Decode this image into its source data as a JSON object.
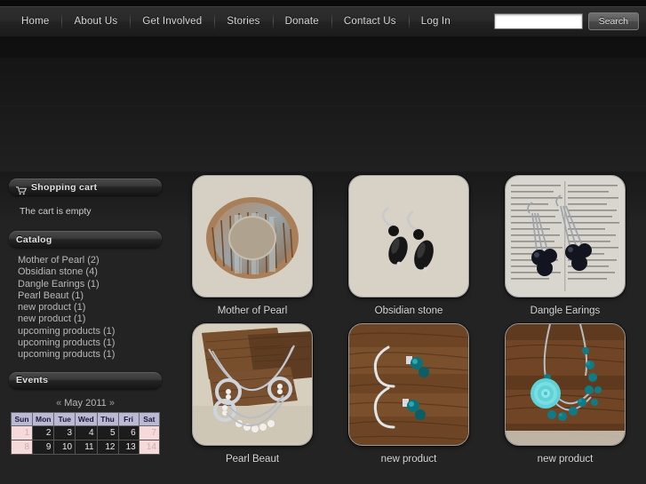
{
  "nav": {
    "items": [
      {
        "label": "Home"
      },
      {
        "label": "About Us"
      },
      {
        "label": "Get Involved"
      },
      {
        "label": "Stories"
      },
      {
        "label": "Donate"
      },
      {
        "label": "Contact Us"
      },
      {
        "label": "Log In"
      }
    ],
    "search": {
      "value": "",
      "placeholder": "",
      "button_label": "Search"
    }
  },
  "sidebar": {
    "cart": {
      "title": "Shopping cart",
      "icon": "shopping-cart-icon",
      "empty_text": "The cart is empty"
    },
    "catalog": {
      "title": "Catalog",
      "items": [
        {
          "label": "Mother of Pearl (2)"
        },
        {
          "label": "Obsidian stone (4)"
        },
        {
          "label": "Dangle Earings (1)"
        },
        {
          "label": "Pearl Beaut (1)"
        },
        {
          "label": "new product (1)"
        },
        {
          "label": "new product (1)"
        },
        {
          "label": "upcoming products (1)"
        },
        {
          "label": "upcoming products (1)"
        },
        {
          "label": "upcoming products (1)"
        }
      ]
    },
    "events": {
      "title": "Events",
      "calendar": {
        "prev_label": "«",
        "month_label": "May 2011",
        "next_label": "»",
        "weekday_headers": [
          "Sun",
          "Mon",
          "Tue",
          "Wed",
          "Thu",
          "Fri",
          "Sat"
        ],
        "weeks": [
          [
            "1",
            "2",
            "3",
            "4",
            "5",
            "6",
            "7"
          ],
          [
            "8",
            "9",
            "10",
            "11",
            "12",
            "13",
            "14"
          ]
        ]
      }
    }
  },
  "products": [
    {
      "name": "Mother of Pearl",
      "image": "mother-of-pearl-bracelet"
    },
    {
      "name": "Obsidian stone",
      "image": "obsidian-stone-earrings"
    },
    {
      "name": "Dangle Earings",
      "image": "dangle-earrings-on-newsprint"
    },
    {
      "name": "Pearl Beaut",
      "image": "pearl-necklace-on-wood"
    },
    {
      "name": "new product",
      "image": "teal-earrings-on-wood"
    },
    {
      "name": "new product",
      "image": "teal-rose-necklace"
    }
  ],
  "colors": {
    "page_background": "#0d0d0d",
    "content_background": "#232323",
    "nav_text": "#d7d7d7",
    "link_text": "#b9b9b9",
    "calendar_header": "#b9b9d6",
    "calendar_weekend": "#f6dada"
  }
}
